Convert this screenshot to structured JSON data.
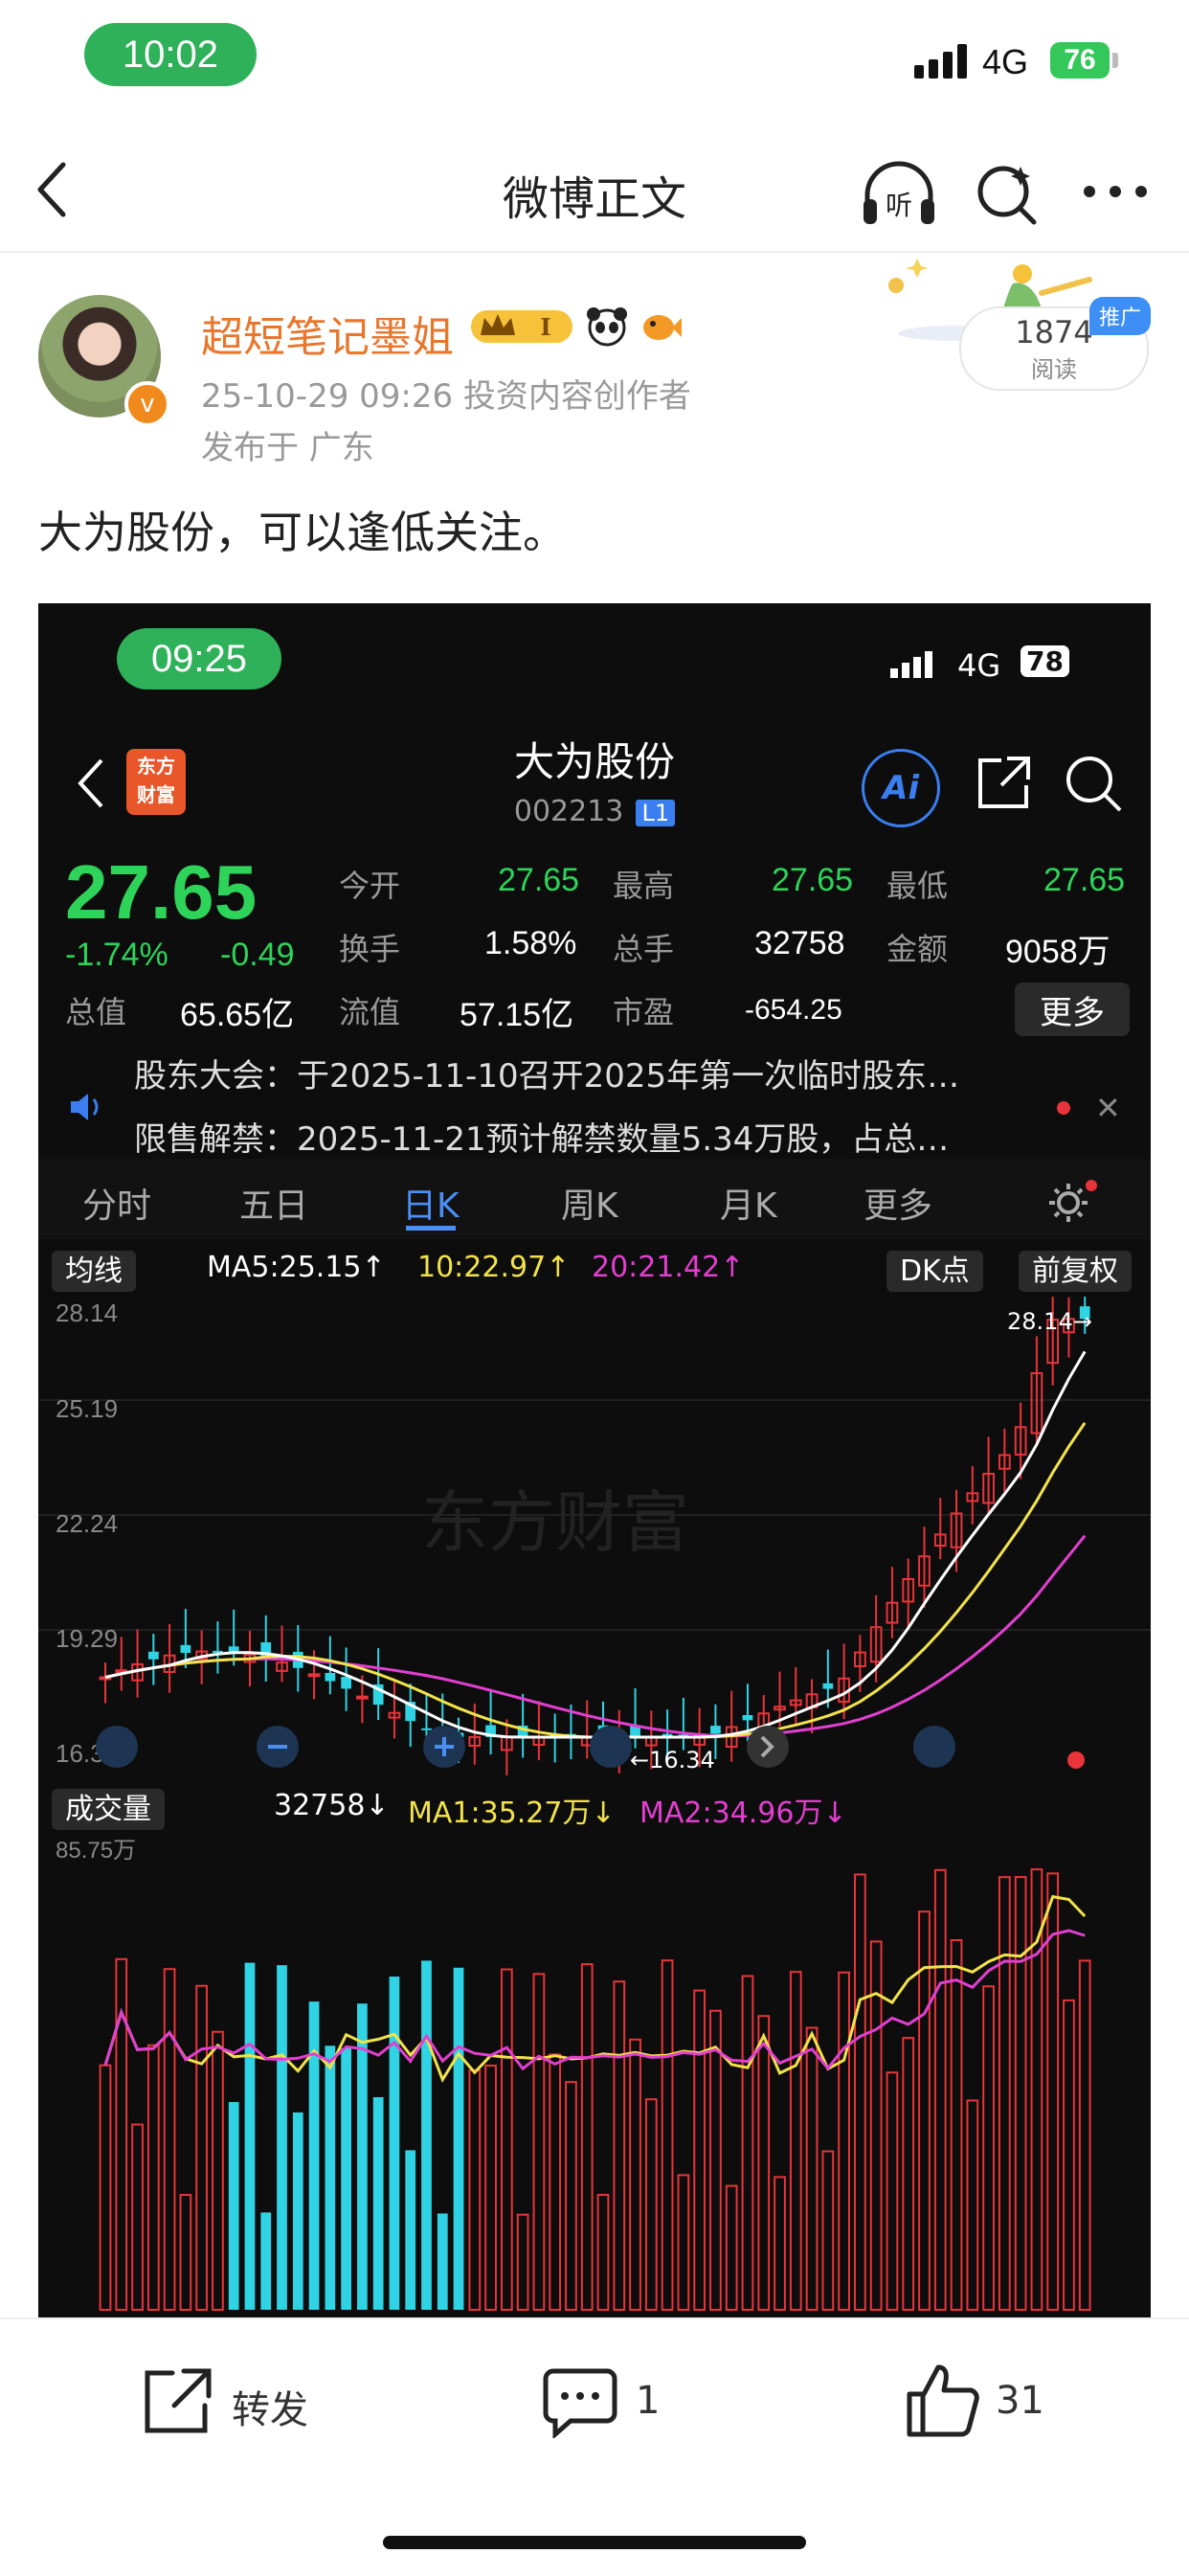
{
  "status_bar": {
    "time": "10:02",
    "network": "4G",
    "battery": "76"
  },
  "nav": {
    "title": "微博正文"
  },
  "author": {
    "name": "超短笔记墨姐",
    "meta": "25-10-29 09:26  投资内容创作者",
    "location": "发布于 广东"
  },
  "stats": {
    "reads": "1874",
    "reads_label": "阅读",
    "promo": "推广"
  },
  "post": {
    "text": "大为股份，可以逢低关注。"
  },
  "screenshot": {
    "status_time": "09:25",
    "status_network": "4G",
    "status_battery": "78",
    "logo": "东方\n财富",
    "title": "大为股份",
    "code": "002213",
    "level": "L1",
    "ai": "Ai",
    "price": "27.65",
    "change_pct": "-1.74%",
    "change_abs": "-0.49",
    "quote": {
      "open_label": "今开",
      "open": "27.65",
      "high_label": "最高",
      "high": "27.65",
      "low_label": "最低",
      "low": "27.65",
      "turnover_label": "换手",
      "turnover": "1.58%",
      "volume_label": "总手",
      "volume": "32758",
      "amount_label": "金额",
      "amount": "9058万",
      "mktcap_label": "总值",
      "mktcap": "65.65亿",
      "float_label": "流值",
      "float": "57.15亿",
      "pe_label": "市盈",
      "pe": "-654.25",
      "more": "更多"
    },
    "notices": [
      "股东大会：于2025-11-10召开2025年第一次临时股东…",
      "限售解禁：2025-11-21预计解禁数量5.34万股，占总…"
    ],
    "tabs": [
      "分时",
      "五日",
      "日K",
      "周K",
      "月K",
      "更多"
    ],
    "active_tab": "日K",
    "ma": {
      "chip": "均线",
      "ma5": "MA5:25.15↑",
      "ma10": "10:22.97↑",
      "ma20": "20:21.42↑",
      "dk": "DK点",
      "adj": "前复权"
    },
    "price_axis": [
      "28.14",
      "25.19",
      "22.24",
      "19.29",
      "16.34"
    ],
    "high_marker": "28.14→",
    "low_marker": "←16.34",
    "vol": {
      "chip": "成交量",
      "value": "32758↓",
      "ma1": "MA1:35.27万↓",
      "ma2": "MA2:34.96万↓",
      "axis_top": "85.75万"
    },
    "colors": {
      "up": "#e8343a",
      "down": "#2fd3e3",
      "ma5": "#ffffff",
      "ma10": "#f2e24a",
      "ma20": "#e23fd0"
    },
    "watermark": "东方财富"
  },
  "actions": {
    "repost": "转发",
    "comments": "1",
    "likes": "31"
  },
  "chart_data": {
    "type": "candlestick",
    "ylim": [
      16.34,
      28.14
    ],
    "y_ticks": [
      28.14,
      25.19,
      22.24,
      19.29,
      16.34
    ],
    "max_marker": 28.14,
    "min_marker": 16.34,
    "last_close": 27.65,
    "series": [
      {
        "name": "MA5",
        "last": 25.15
      },
      {
        "name": "10",
        "last": 22.97
      },
      {
        "name": "20",
        "last": 21.42
      }
    ],
    "volume": {
      "last": 32758,
      "ymax_label": "85.75万",
      "ma1": "35.27万",
      "ma2": "34.96万"
    }
  }
}
